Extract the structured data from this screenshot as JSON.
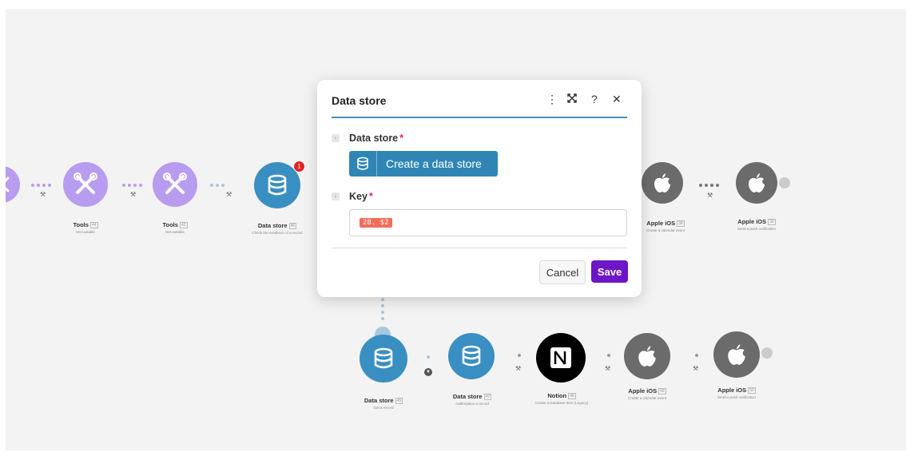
{
  "modal": {
    "title": "Data store",
    "field1_label": "Data store",
    "required_mark": "*",
    "create_button": "Create a data store",
    "field2_label": "Key",
    "key_value": "28. $2",
    "cancel": "Cancel",
    "save": "Save",
    "icons": [
      "more-vertical-icon",
      "expand-icon",
      "help-icon",
      "close-icon"
    ]
  },
  "flow_top": [
    {
      "title": "Tools",
      "id": "44",
      "subtitle": "Set variable"
    },
    {
      "title": "Tools",
      "id": "42",
      "subtitle": "Set variable"
    },
    {
      "title": "Data store",
      "id": "46",
      "subtitle": "Check the existence of a record",
      "badge": "1"
    },
    {
      "title": "Apple iOS",
      "id": "38",
      "subtitle": "Create a calendar event"
    },
    {
      "title": "Apple iOS",
      "id": "39",
      "subtitle": "Send a push notification"
    }
  ],
  "flow_bottom": [
    {
      "title": "Data store",
      "id": "45",
      "subtitle": "Get a record"
    },
    {
      "title": "Data store",
      "id": "47",
      "subtitle": "Add/replace a record"
    },
    {
      "title": "Notion",
      "id": "48",
      "subtitle": "Create a Database Item (Legacy)"
    },
    {
      "title": "Apple iOS",
      "id": "49",
      "subtitle": "Create a calendar event"
    },
    {
      "title": "Apple iOS",
      "id": "50",
      "subtitle": "Send a push notification"
    }
  ],
  "colors": {
    "tools": "#b79cf0",
    "datastore": "#3a8fc2",
    "apple": "#6b6b6b",
    "notion": "#000000",
    "save": "#6d16c7",
    "key_pill": "#f26d5b"
  }
}
